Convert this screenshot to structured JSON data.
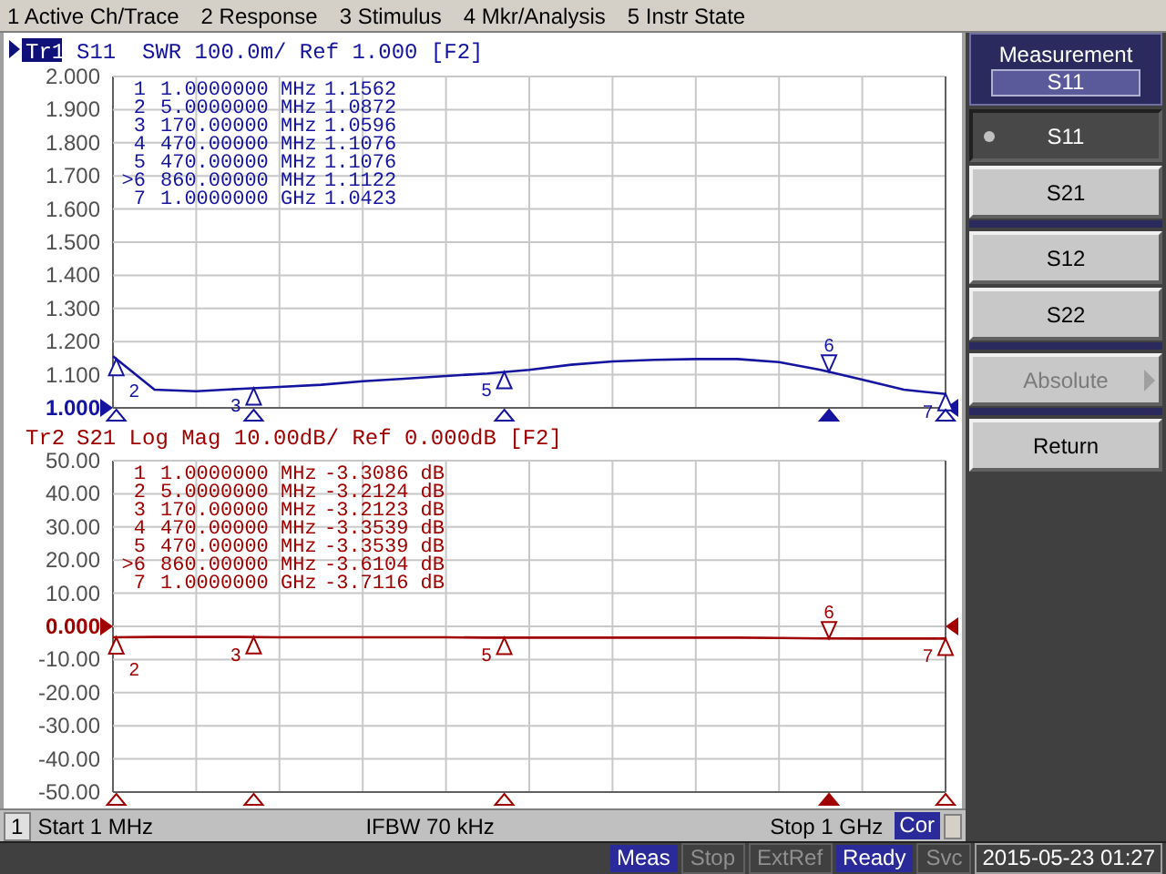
{
  "menu": [
    "1 Active Ch/Trace",
    "2 Response",
    "3 Stimulus",
    "4 Mkr/Analysis",
    "5 Instr State"
  ],
  "traces": [
    {
      "label": "Tr1",
      "active": true,
      "color": "#1414a0",
      "header": "S11  SWR 100.0m/ Ref 1.000 [F2]",
      "markers": [
        {
          "label": "2",
          "active": false
        },
        {
          "label": "3",
          "active": false
        },
        {
          "label": "5",
          "active": false
        },
        {
          "label": "6",
          "active": true
        },
        {
          "label": "7",
          "active": false
        }
      ],
      "readout": [
        {
          "label": "1",
          "freq": "1.0000000 MHz",
          "value": "1.1562"
        },
        {
          "label": "2",
          "freq": "5.0000000 MHz",
          "value": "1.0872"
        },
        {
          "label": "3",
          "freq": "170.00000 MHz",
          "value": "1.0596"
        },
        {
          "label": "4",
          "freq": "470.00000 MHz",
          "value": "1.1076"
        },
        {
          "label": "5",
          "freq": "470.00000 MHz",
          "value": "1.1076"
        },
        {
          "label": ">6",
          "freq": "860.00000 MHz",
          "value": "1.1122"
        },
        {
          "label": "7",
          "freq": "1.0000000 GHz",
          "value": "1.0423"
        }
      ],
      "chart_data": {
        "type": "line",
        "ylim": [
          1,
          2
        ],
        "grid": true,
        "yticks": [
          {
            "value": 2,
            "label": "2.000"
          },
          {
            "value": 1.9,
            "label": "1.900"
          },
          {
            "value": 1.8,
            "label": "1.800"
          },
          {
            "value": 1.7,
            "label": "1.700"
          },
          {
            "value": 1.6,
            "label": "1.600"
          },
          {
            "value": 1.5,
            "label": "1.500"
          },
          {
            "value": 1.4,
            "label": "1.400"
          },
          {
            "value": 1.3,
            "label": "1.300"
          },
          {
            "value": 1.2,
            "label": "1.200"
          },
          {
            "value": 1.1,
            "label": "1.100"
          },
          {
            "value": 1,
            "label": "1.000"
          }
        ],
        "categories": [
          null,
          null,
          null,
          null,
          null,
          null,
          null,
          null,
          null,
          null,
          null,
          null,
          null,
          null,
          null,
          null,
          null,
          null,
          null,
          null,
          null
        ],
        "series": [
          {
            "color": "#1414a0",
            "values": [
              1.156,
              1.055,
              1.05,
              1.057,
              1.063,
              1.07,
              1.08,
              1.088,
              1.096,
              1.104,
              1.115,
              1.13,
              1.14,
              1.145,
              1.147,
              1.147,
              1.138,
              1.115,
              1.085,
              1.055,
              1.042
            ]
          }
        ]
      }
    },
    {
      "label": "Tr2",
      "active": false,
      "color": "#a00000",
      "header": "S21 Log Mag 10.00dB/ Ref 0.000dB [F2]",
      "markers": [
        {
          "label": "2",
          "active": false
        },
        {
          "label": "3",
          "active": false
        },
        {
          "label": "5",
          "active": false
        },
        {
          "label": "6",
          "active": true
        },
        {
          "label": "7",
          "active": false
        }
      ],
      "readout": [
        {
          "label": "1",
          "freq": "1.0000000 MHz",
          "value": "-3.3086 dB"
        },
        {
          "label": "2",
          "freq": "5.0000000 MHz",
          "value": "-3.2124 dB"
        },
        {
          "label": "3",
          "freq": "170.00000 MHz",
          "value": "-3.2123 dB"
        },
        {
          "label": "4",
          "freq": "470.00000 MHz",
          "value": "-3.3539 dB"
        },
        {
          "label": "5",
          "freq": "470.00000 MHz",
          "value": "-3.3539 dB"
        },
        {
          "label": ">6",
          "freq": "860.00000 MHz",
          "value": "-3.6104 dB"
        },
        {
          "label": "7",
          "freq": "1.0000000 GHz",
          "value": "-3.7116 dB"
        }
      ],
      "chart_data": {
        "type": "line",
        "ylim": [
          -50,
          50
        ],
        "grid": true,
        "yticks": [
          {
            "value": 50,
            "label": "50.00"
          },
          {
            "value": 40,
            "label": "40.00"
          },
          {
            "value": 30,
            "label": "30.00"
          },
          {
            "value": 20,
            "label": "20.00"
          },
          {
            "value": 10,
            "label": "10.00"
          },
          {
            "value": 0,
            "label": "0.000"
          },
          {
            "value": -10,
            "label": "-10.00"
          },
          {
            "value": -20,
            "label": "-20.00"
          },
          {
            "value": -30,
            "label": "-30.00"
          },
          {
            "value": -40,
            "label": "-40.00"
          },
          {
            "value": -50,
            "label": "-50.00"
          }
        ],
        "categories": [
          null,
          null,
          null,
          null,
          null,
          null,
          null,
          null,
          null,
          null,
          null,
          null,
          null,
          null,
          null,
          null,
          null,
          null,
          null,
          null,
          null
        ],
        "series": [
          {
            "color": "#a00000",
            "values": [
              -3.3,
              -3.2,
              -3.2,
              -3.2,
              -3.3,
              -3.3,
              -3.3,
              -3.3,
              -3.3,
              -3.4,
              -3.4,
              -3.4,
              -3.4,
              -3.4,
              -3.4,
              -3.4,
              -3.5,
              -3.6,
              -3.7,
              -3.7,
              -3.7
            ]
          }
        ]
      }
    }
  ],
  "channel_status": {
    "channel": "1",
    "start": "Start 1 MHz",
    "ifbw": "IFBW 70 kHz",
    "stop": "Stop 1 GHz",
    "correction": {
      "label": "Cor",
      "on": true
    }
  },
  "softkeys": {
    "title": "Measurement",
    "value": "S11",
    "items": [
      {
        "label": "S11",
        "kind": "option",
        "selected": true,
        "disabled": false,
        "separator_before": false
      },
      {
        "label": "S21",
        "kind": "option",
        "selected": false,
        "disabled": false,
        "separator_before": false
      },
      {
        "label": "S12",
        "kind": "option",
        "selected": false,
        "disabled": false,
        "separator_before": true
      },
      {
        "label": "S22",
        "kind": "option",
        "selected": false,
        "disabled": false,
        "separator_before": false
      },
      {
        "label": "Absolute",
        "kind": "submenu",
        "selected": false,
        "disabled": true,
        "separator_before": true
      },
      {
        "label": "Return",
        "kind": "option",
        "selected": false,
        "disabled": false,
        "separator_before": true
      }
    ]
  },
  "status_bar": {
    "indicators": [
      {
        "label": "Meas",
        "on": true
      },
      {
        "label": "Stop",
        "on": false
      },
      {
        "label": "ExtRef",
        "on": false
      },
      {
        "label": "Ready",
        "on": true
      },
      {
        "label": "Svc",
        "on": false
      }
    ],
    "datetime": "2015-05-23 01:27"
  }
}
